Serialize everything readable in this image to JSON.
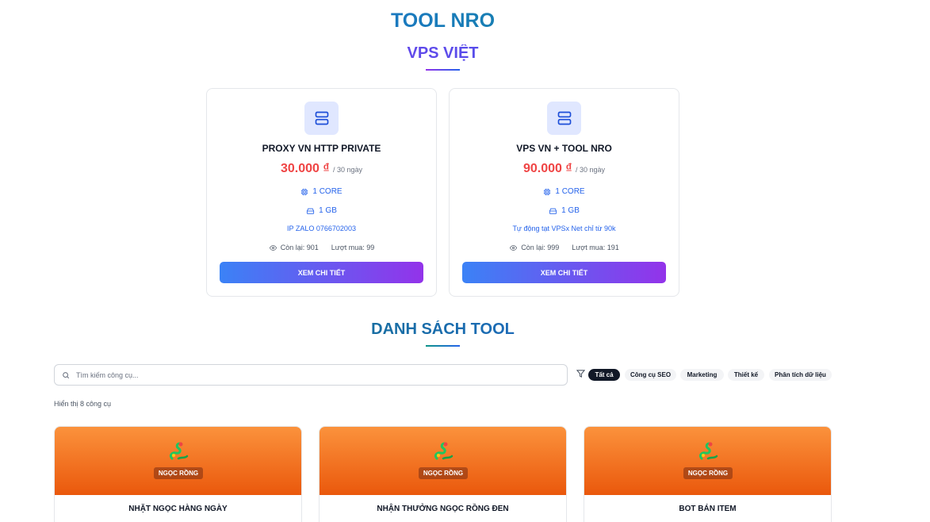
{
  "header": {
    "title": "TOOL NRO",
    "vps_section_title": "VPS VIỆT",
    "tools_section_title": "DANH SÁCH TOOL"
  },
  "vps_plans": [
    {
      "name": "PROXY VN HTTP PRIVATE",
      "price": "30.000 ₫",
      "period": "/ 30 ngày",
      "cpu": "1 CORE",
      "ram": "1 GB",
      "note": "IP ZALO 0766702003",
      "remaining": "Còn lại: 901",
      "purchases": "Lượt mua: 99",
      "button_label": "XEM CHI TIẾT"
    },
    {
      "name": "VPS VN + TOOL NRO",
      "price": "90.000 ₫",
      "period": "/ 30 ngày",
      "cpu": "1 CORE",
      "ram": "1 GB",
      "note": "Tự động tạt VPSx Net chỉ từ 90k",
      "remaining": "Còn lại: 999",
      "purchases": "Lượt mua: 191",
      "button_label": "XEM CHI TIẾT"
    }
  ],
  "search": {
    "placeholder": "Tìm kiếm công cụ..."
  },
  "filters": [
    {
      "label": "Tất cả",
      "active": true
    },
    {
      "label": "Công cụ SEO",
      "active": false
    },
    {
      "label": "Marketing",
      "active": false
    },
    {
      "label": "Thiết kế",
      "active": false
    },
    {
      "label": "Phân tích dữ liệu",
      "active": false
    }
  ],
  "result_count": "Hiển thị 8 công cụ",
  "tools": [
    {
      "tag": "NGỌC RỒNG",
      "name": "NHẶT NGỌC HÀNG NGÀY"
    },
    {
      "tag": "NGỌC RỒNG",
      "name": "NHẬN THƯỞNG NGỌC RỒNG ĐEN"
    },
    {
      "tag": "NGỌC RỒNG",
      "name": "BOT BÁN ITEM"
    }
  ],
  "colors": {
    "price": "#ef4444",
    "accent_blue": "#2563eb",
    "button_gradient_start": "#3b82f6",
    "button_gradient_end": "#9333ea",
    "tool_banner": "#f97316"
  },
  "icons": {
    "vps": "server-icon",
    "cpu": "cpu-icon",
    "ram": "hard-drive-icon",
    "stats": "eye-icon",
    "search": "search-icon",
    "filter": "filter-icon",
    "tool": "dragon-icon"
  }
}
